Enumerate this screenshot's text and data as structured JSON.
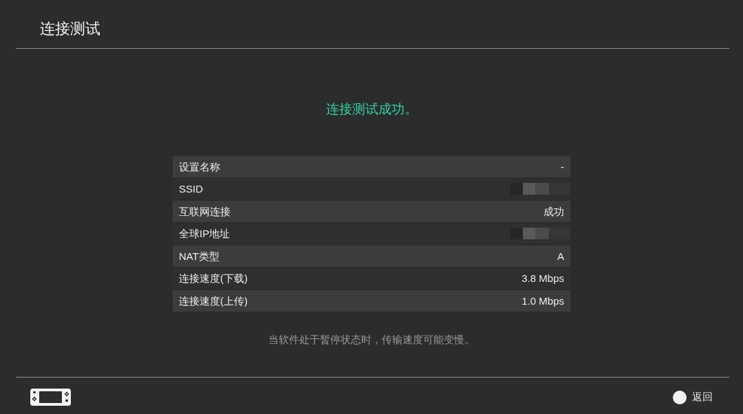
{
  "header": {
    "title": "连接测试"
  },
  "status_message": "连接测试成功。",
  "details": [
    {
      "label": "设置名称",
      "kind": "text",
      "value": "-"
    },
    {
      "label": "SSID",
      "kind": "redacted"
    },
    {
      "label": "互联网连接",
      "kind": "text",
      "value": "成功"
    },
    {
      "label": "全球IP地址",
      "kind": "redacted"
    },
    {
      "label": "NAT类型",
      "kind": "text",
      "value": "A"
    },
    {
      "label": "连接速度(下载)",
      "kind": "text",
      "value": "3.8 Mbps"
    },
    {
      "label": "连接速度(上传)",
      "kind": "text",
      "value": "1.0 Mbps"
    }
  ],
  "note": "当软件处于暂停状态时，传输速度可能变慢。",
  "footer": {
    "back_button": {
      "label": "返回"
    }
  }
}
